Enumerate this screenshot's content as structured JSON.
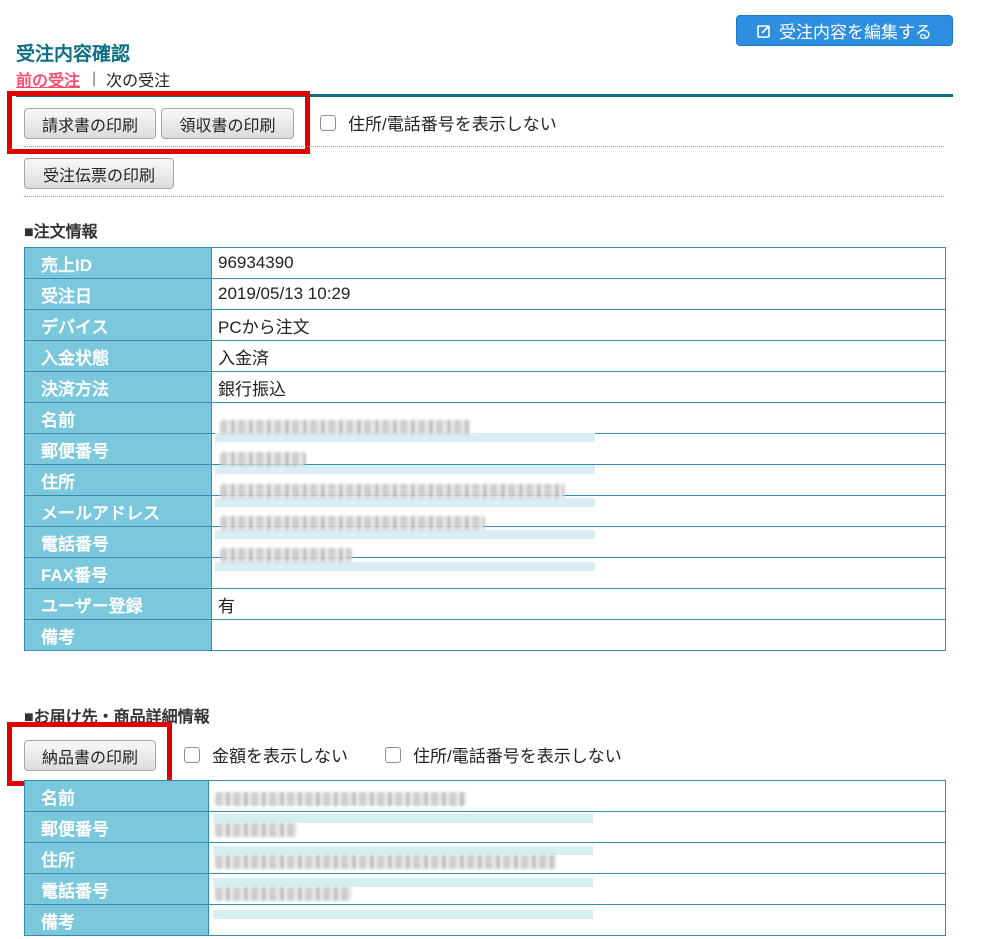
{
  "header": {
    "edit_button": "受注内容を編集する",
    "title": "受注内容確認",
    "prev_link": "前の受注",
    "separator": "|",
    "next_link": "次の受注"
  },
  "print": {
    "invoice": "請求書の印刷",
    "receipt": "領収書の印刷",
    "hide_address_phone": "住所/電話番号を表示しない",
    "order_slip": "受注伝票の印刷"
  },
  "order_info": {
    "heading": "■注文情報",
    "rows": [
      {
        "label": "売上ID",
        "value": "96934390"
      },
      {
        "label": "受注日",
        "value": "2019/05/13 10:29"
      },
      {
        "label": "デバイス",
        "value": "PCから注文"
      },
      {
        "label": "入金状態",
        "value": "入金済"
      },
      {
        "label": "決済方法",
        "value": "銀行振込"
      },
      {
        "label": "名前",
        "value": ""
      },
      {
        "label": "郵便番号",
        "value": ""
      },
      {
        "label": "住所",
        "value": ""
      },
      {
        "label": "メールアドレス",
        "value": ""
      },
      {
        "label": "電話番号",
        "value": ""
      },
      {
        "label": "FAX番号",
        "value": ""
      },
      {
        "label": "ユーザー登録",
        "value": "有"
      },
      {
        "label": "備考",
        "value": ""
      }
    ]
  },
  "delivery": {
    "heading": "■お届け先・商品詳細情報",
    "delivery_note_button": "納品書の印刷",
    "hide_amount": "金額を表示しない",
    "hide_address_phone": "住所/電話番号を表示しない",
    "rows": [
      {
        "label": "名前",
        "value": ""
      },
      {
        "label": "郵便番号",
        "value": ""
      },
      {
        "label": "住所",
        "value": ""
      },
      {
        "label": "電話番号",
        "value": ""
      },
      {
        "label": "備考",
        "value": ""
      }
    ]
  },
  "colors": {
    "accent": "#2e8fe0",
    "title": "#0d6f86",
    "label_bg": "#7bc7dc",
    "highlight": "#e10000",
    "prev_link": "#ff4b6e"
  }
}
